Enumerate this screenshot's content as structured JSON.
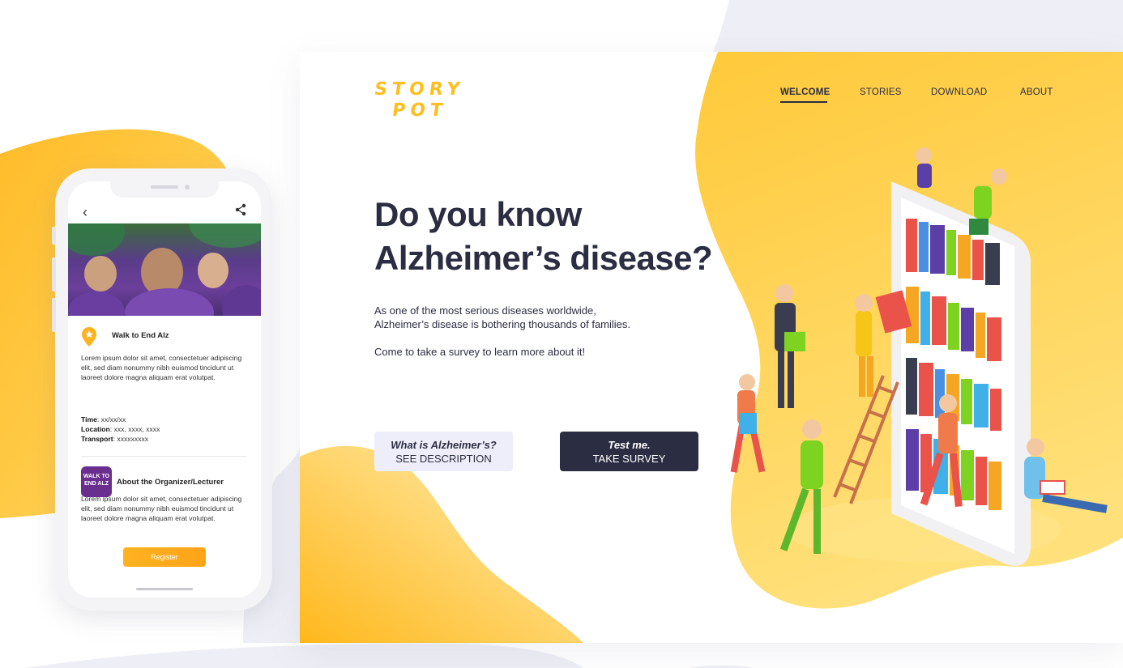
{
  "page": {
    "brand_color": "#ffbe1f",
    "dark_color": "#2b2d42",
    "light_button_color": "#eeeefa"
  },
  "phone": {
    "back_icon": "chevron-left-icon",
    "share_icon": "share-icon",
    "event": {
      "icon": "location-pin-star-icon",
      "title": "Walk to End Alz",
      "description": "Lorem ipsum dolor sit amet, consectetuer adipiscing elit, sed diam nonummy nibh euismod tincidunt ut laoreet dolore magna aliquam erat volutpat.",
      "time_label": "Time",
      "time_value": ": xx/xx/xx",
      "location_label": "Location",
      "location_value": ": xxx, xxxx, xxxx",
      "transport_label": "Transport",
      "transport_value": ": xxxxxxxxx"
    },
    "organizer": {
      "logo_text": "WALK TO END ALZ",
      "title": "About the Organizer/Lecturer",
      "description": "Lorem ipsum dolor sit amet, consectetuer adipiscing elit, sed diam nonummy nibh euismod tincidunt ut laoreet dolore magna aliquam erat volutpat."
    },
    "register_label": "Register"
  },
  "site": {
    "logo": {
      "line1": "STORY",
      "line2": "POT"
    },
    "nav": [
      {
        "label": "WELCOME",
        "active": true
      },
      {
        "label": "STORIES",
        "active": false
      },
      {
        "label": "DOWNLOAD",
        "active": false
      },
      {
        "label": "ABOUT",
        "active": false
      }
    ],
    "headline_line1": "Do you know",
    "headline_line2": "Alzheimer’s disease?",
    "intro_line1": "As one of the most serious diseases worldwide,",
    "intro_line2": "Alzheimer’s disease is bothering thousands of families.",
    "cta_text": "Come to take a survey to learn more about it!",
    "buttons": {
      "description": {
        "emph": "What is Alzheimer’s?",
        "label": "SEE DESCRIPTION"
      },
      "survey": {
        "emph": "Test me.",
        "label": "TAKE SURVEY"
      }
    },
    "illustration_name": "people-with-book-shelf-phone-illustration"
  }
}
